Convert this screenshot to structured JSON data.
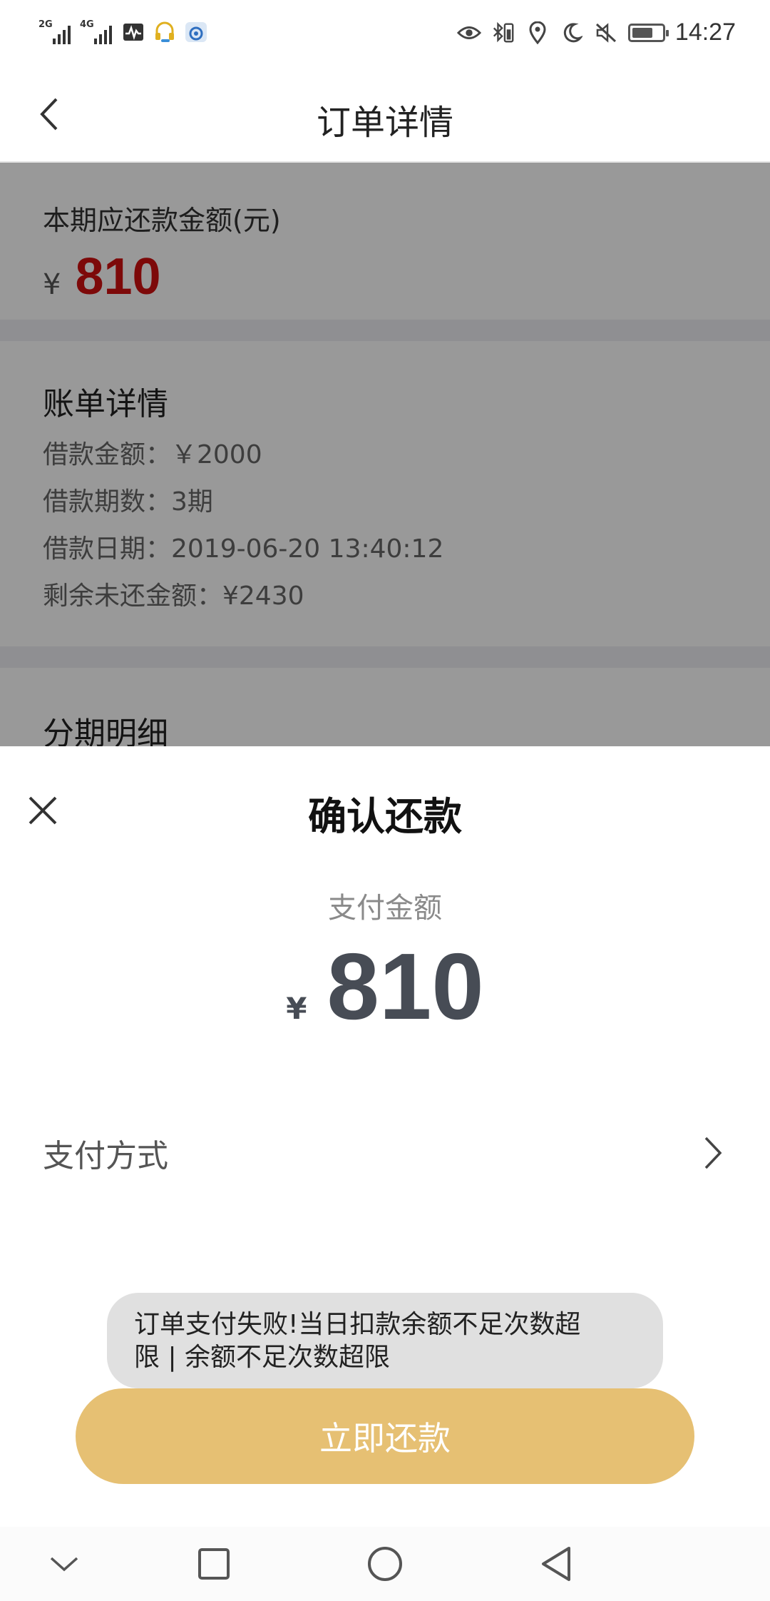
{
  "status_bar": {
    "signal_1_label": "2G",
    "signal_2_label": "4G",
    "time": "14:27",
    "battery_level": 0.7,
    "icons": [
      "activity-icon",
      "headset-icon",
      "app-icon",
      "eye-icon",
      "bluetooth-icon",
      "vibrate-icon",
      "location-icon",
      "moon-icon",
      "mute-icon",
      "battery-icon"
    ]
  },
  "header": {
    "title": "订单详情",
    "back_icon": "chevron-left-icon"
  },
  "amount_card": {
    "label": "本期应还款金额(元)",
    "currency": "¥",
    "value": "810",
    "value_color": "#d01010"
  },
  "bill": {
    "title": "账单详情",
    "lines": [
      "借款金额：￥2000",
      "借款期数：3期",
      "借款日期：2019-06-20 13:40:12",
      "剩余未还金额：¥2430"
    ]
  },
  "installments": {
    "title": "分期明细"
  },
  "sheet": {
    "title": "确认还款",
    "close_icon": "close-icon",
    "pay_label": "支付金额",
    "pay_currency": "¥",
    "pay_value": "810",
    "pay_method_label": "支付方式",
    "pay_method_icon": "chevron-right-icon",
    "button_label": "立即还款",
    "button_color": "#e6c073"
  },
  "toast": {
    "line1": "订单支付失败!当日扣款余额不足次数超",
    "line2": "限 | 余额不足次数超限"
  },
  "nav_bar": {
    "icons": [
      "hide-keyboard-icon",
      "recents-icon",
      "home-icon",
      "back-icon"
    ]
  }
}
